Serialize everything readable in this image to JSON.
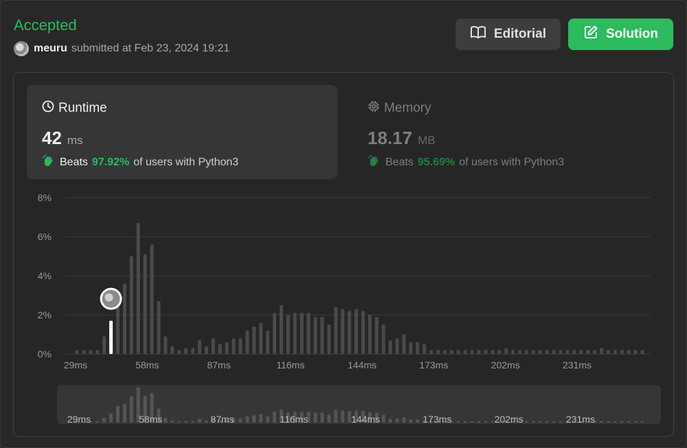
{
  "result": {
    "status": "Accepted",
    "username": "meuru",
    "submitted_text": "submitted at Feb 23, 2024 19:21"
  },
  "buttons": {
    "editorial": "Editorial",
    "solution": "Solution"
  },
  "runtime": {
    "label": "Runtime",
    "value": "42",
    "unit": "ms",
    "beats_word": "Beats",
    "beats_pct": "97.92%",
    "beats_rest": "of users with Python3"
  },
  "memory": {
    "label": "Memory",
    "value": "18.17",
    "unit": "MB",
    "beats_word": "Beats",
    "beats_pct": "95.69%",
    "beats_rest": "of users with Python3"
  },
  "colors": {
    "accent": "#2cbb5d",
    "bar": "#4a4a4a",
    "highlight": "#ffffff"
  },
  "icons": {
    "editorial": "book-open-icon",
    "solution": "edit-icon",
    "runtime": "clock-icon",
    "memory": "chip-icon",
    "beats": "clapping-hand-icon"
  },
  "chart_data": {
    "type": "bar",
    "title": "",
    "xlabel": "",
    "ylabel": "",
    "ylim": [
      0,
      8
    ],
    "yticks": [
      "0%",
      "2%",
      "4%",
      "6%",
      "8%"
    ],
    "xticks": [
      "29ms",
      "58ms",
      "87ms",
      "116ms",
      "144ms",
      "173ms",
      "202ms",
      "231ms"
    ],
    "grid": true,
    "highlight_index": 5,
    "highlight_label": "42ms",
    "values": [
      0.2,
      0.2,
      0.2,
      0.2,
      0.9,
      1.7,
      3.2,
      3.6,
      5.0,
      6.7,
      5.1,
      5.6,
      2.7,
      0.9,
      0.4,
      0.2,
      0.3,
      0.3,
      0.7,
      0.4,
      0.8,
      0.5,
      0.6,
      0.8,
      0.8,
      1.2,
      1.4,
      1.6,
      1.2,
      2.1,
      2.5,
      2.0,
      2.1,
      2.1,
      2.1,
      1.9,
      1.9,
      1.5,
      2.4,
      2.3,
      2.2,
      2.3,
      2.2,
      2.0,
      1.9,
      1.5,
      0.7,
      0.8,
      1.0,
      0.6,
      0.6,
      0.5,
      0.2,
      0.2,
      0.2,
      0.2,
      0.2,
      0.2,
      0.2,
      0.2,
      0.2,
      0.2,
      0.2,
      0.3,
      0.2,
      0.2,
      0.2,
      0.2,
      0.2,
      0.2,
      0.2,
      0.2,
      0.2,
      0.2,
      0.2,
      0.2,
      0.2,
      0.3,
      0.2,
      0.2,
      0.2,
      0.2,
      0.2,
      0.2
    ]
  }
}
